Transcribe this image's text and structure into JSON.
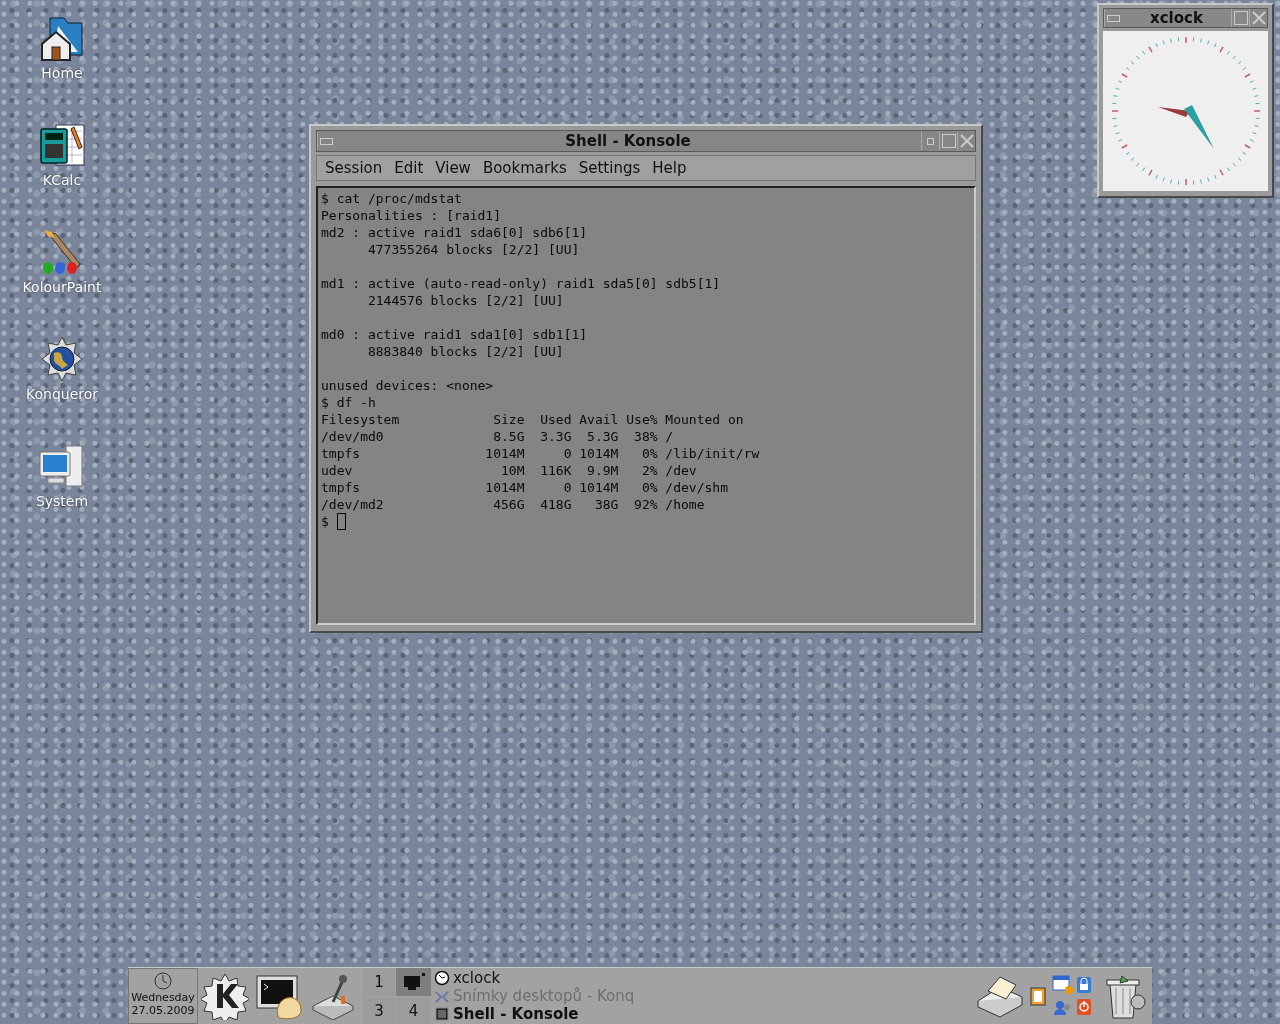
{
  "desktop_icons": [
    {
      "label": "Home",
      "kind": "home"
    },
    {
      "label": "KCalc",
      "kind": "calculator"
    },
    {
      "label": "KolourPaint",
      "kind": "paint"
    },
    {
      "label": "Konqueror",
      "kind": "globe"
    },
    {
      "label": "System",
      "kind": "computer"
    }
  ],
  "terminal_window": {
    "title": "Shell - Konsole",
    "menu": [
      "Session",
      "Edit",
      "View",
      "Bookmarks",
      "Settings",
      "Help"
    ],
    "blocks": [
      [
        "$ cat /proc/mdstat",
        "Personalities : [raid1]",
        "md2 : active raid1 sda6[0] sdb6[1]",
        "      477355264 blocks [2/2] [UU]"
      ],
      [
        "md1 : active (auto-read-only) raid1 sda5[0] sdb5[1]",
        "      2144576 blocks [2/2] [UU]"
      ],
      [
        "md0 : active raid1 sda1[0] sdb1[1]",
        "      8883840 blocks [2/2] [UU]"
      ],
      [
        "unused devices: <none>",
        "$ df -h",
        "Filesystem            Size  Used Avail Use% Mounted on",
        "/dev/md0              8.5G  3.3G  5.3G  38% /",
        "tmpfs                1014M     0 1014M   0% /lib/init/rw",
        "udev                   10M  116K  9.9M   2% /dev",
        "tmpfs                1014M     0 1014M   0% /dev/shm",
        "/dev/md2              456G  418G   38G  92% /home"
      ]
    ],
    "prompt": "$"
  },
  "clock_window": {
    "title": "xclock"
  },
  "taskbar": {
    "clock": {
      "day": "Wednesday",
      "date": "27.05.2009"
    },
    "launchers": [
      {
        "kind": "kmenu"
      },
      {
        "kind": "terminal"
      },
      {
        "kind": "joystick"
      }
    ],
    "pager": [
      {
        "kind": "number",
        "label": "1",
        "selected": false
      },
      {
        "kind": "thumbnail",
        "selected": true
      },
      {
        "kind": "number",
        "label": "3",
        "selected": false
      },
      {
        "kind": "number",
        "label": "4",
        "selected": false
      }
    ],
    "tasks": [
      {
        "label": "xclock",
        "kind": "clock",
        "active": false,
        "minimized": false
      },
      {
        "label": "Snímky desktopů - Konq",
        "kind": "konqueror",
        "active": false,
        "minimized": true
      },
      {
        "label": "Shell - Konsole",
        "kind": "terminal",
        "active": true,
        "minimized": false
      }
    ]
  }
}
